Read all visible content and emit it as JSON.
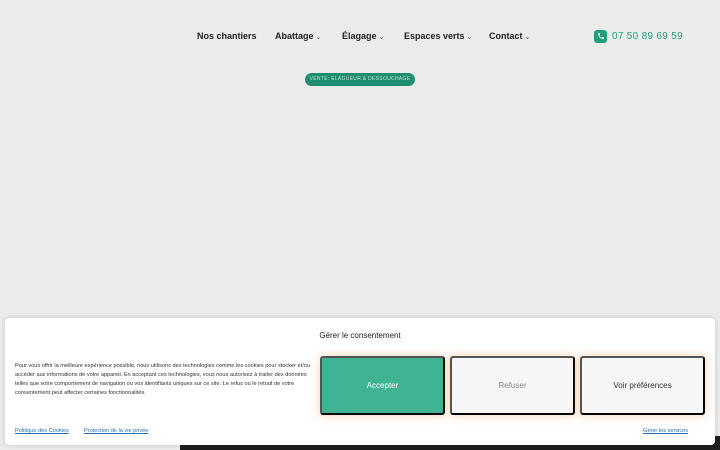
{
  "nav": {
    "items": [
      {
        "label": "Nos chantiers",
        "has_dropdown": false
      },
      {
        "label": "Abattage",
        "has_dropdown": true
      },
      {
        "label": "Élagage",
        "has_dropdown": true
      },
      {
        "label": "Espaces verts",
        "has_dropdown": true
      },
      {
        "label": "Contact",
        "has_dropdown": true
      }
    ],
    "chevron": "⌄",
    "phone": "07 50 89 69 59"
  },
  "hero": {
    "pill_text": "VENTE: ELAGUEUR & DESSOUCHAGE"
  },
  "consent": {
    "title": "Gérer le consentement",
    "text": "Pour vous offrir la meilleure expérience possible, nous utilisons des technologies comme les cookies pour stocker et/ou accéder aux informations de votre appareil. En acceptant ces technologies, vous nous autorisez à traiter des données telles que votre comportement de navigation ou vos identifiants uniques sur ce site. Le refus ou le retrait de votre consentement peut affecter certaines fonctionnalités.",
    "accept_label": "Accepter",
    "refuse_label": "Refuser",
    "prefs_label": "Voir préférences",
    "cookie_policy_link": "Politique des Cookies",
    "privacy_link": "Protection de la vie privée",
    "manage_services_link": "Gérer les services"
  },
  "colors": {
    "brand_green": "#1f9e7b",
    "accept_bg": "#3fb394",
    "page_bg": "#ebebeb"
  }
}
